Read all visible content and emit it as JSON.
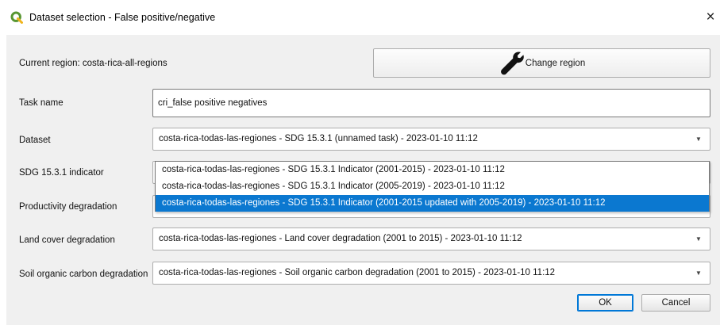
{
  "window": {
    "title": "Dataset selection - False positive/negative",
    "close_symbol": "×",
    "app_icon": "qgis-logo-icon"
  },
  "region": {
    "label": "Current region: costa-rica-all-regions",
    "change_button": "Change region",
    "change_icon": "wrench-icon"
  },
  "task": {
    "label": "Task name",
    "value": "cri_false positive negatives"
  },
  "dataset": {
    "label": "Dataset",
    "value": "costa-rica-todas-las-regiones - SDG 15.3.1 (unnamed task) - 2023-01-10 11:12"
  },
  "indicator": {
    "label": "SDG 15.3.1 indicator",
    "options": [
      "costa-rica-todas-las-regiones - SDG 15.3.1 Indicator (2001-2015) - 2023-01-10 11:12",
      "costa-rica-todas-las-regiones - SDG 15.3.1 Indicator (2005-2019) - 2023-01-10 11:12",
      "costa-rica-todas-las-regiones - SDG 15.3.1 Indicator (2001-2015 updated with 2005-2019) - 2023-01-10 11:12"
    ],
    "selected_index": 2
  },
  "productivity": {
    "label": "Productivity degradation"
  },
  "land_cover": {
    "label": "Land cover degradation",
    "value": "costa-rica-todas-las-regiones - Land cover degradation (2001 to 2015) - 2023-01-10 11:12"
  },
  "soil_carbon": {
    "label": "Soil organic carbon degradation",
    "value": "costa-rica-todas-las-regiones - Soil organic carbon degradation (2001 to 2015) - 2023-01-10 11:12"
  },
  "buttons": {
    "ok": "OK",
    "cancel": "Cancel"
  },
  "colors": {
    "selection": "#0b78d0",
    "dialog_bg": "#f0f0f0",
    "qgis_green": "#589632",
    "qgis_yellow": "#f0b41a"
  }
}
